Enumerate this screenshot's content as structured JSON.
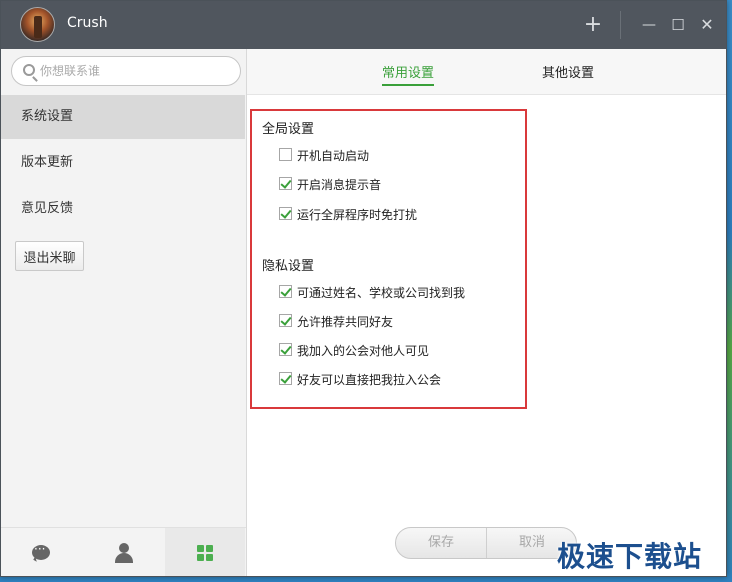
{
  "window": {
    "title": "Crush",
    "titlebar_buttons": {
      "add": "+",
      "minimize": "—",
      "maximize": "☐",
      "close": "✕"
    }
  },
  "sidebar": {
    "search": {
      "placeholder": "你想联系谁"
    },
    "items": [
      {
        "label": "系统设置",
        "active": true
      },
      {
        "label": "版本更新",
        "active": false
      },
      {
        "label": "意见反馈",
        "active": false
      }
    ],
    "exit_label": "退出米聊",
    "bottom_icons": [
      "chat-icon",
      "contacts-icon",
      "apps-icon"
    ],
    "active_bottom": "apps-icon"
  },
  "main": {
    "tabs": [
      {
        "label": "常用设置",
        "active": true
      },
      {
        "label": "其他设置",
        "active": false
      }
    ],
    "global": {
      "title": "全局设置",
      "options": [
        {
          "label": "开机自动启动",
          "checked": false
        },
        {
          "label": "开启消息提示音",
          "checked": true
        },
        {
          "label": "运行全屏程序时免打扰",
          "checked": true
        }
      ]
    },
    "privacy": {
      "title": "隐私设置",
      "options": [
        {
          "label": "可通过姓名、学校或公司找到我",
          "checked": true
        },
        {
          "label": "允许推荐共同好友",
          "checked": true
        },
        {
          "label": "我加入的公会对他人可见",
          "checked": true
        },
        {
          "label": "好友可以直接把我拉入公会",
          "checked": true
        }
      ]
    },
    "footer": {
      "save_label": "保存",
      "cancel_label": "取消"
    }
  },
  "watermark": "极速下载站",
  "colors": {
    "accent": "#3aa03a",
    "titlebar": "#50565e",
    "highlight": "#d9393b"
  }
}
